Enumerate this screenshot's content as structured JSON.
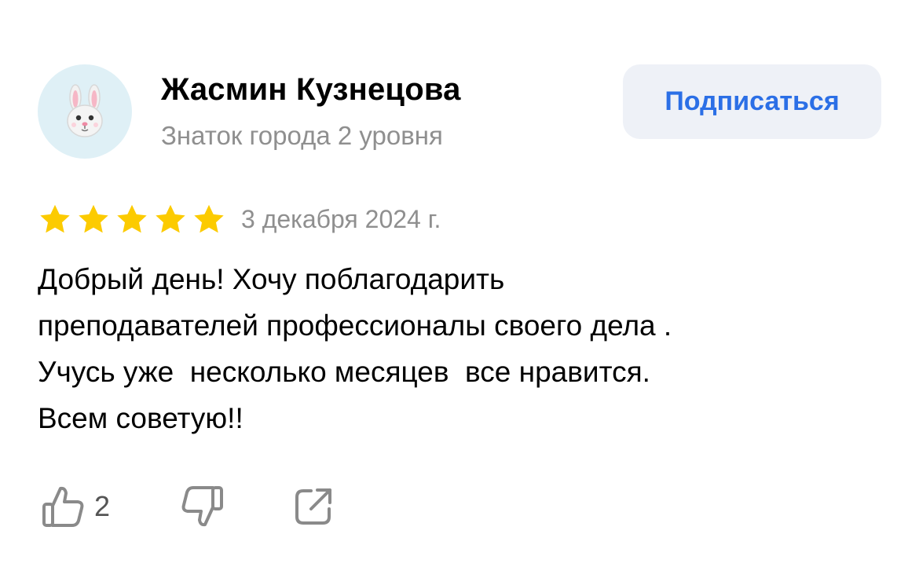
{
  "author": {
    "name": "Жасмин Кузнецова",
    "level": "Знаток города 2 уровня",
    "avatar_icon": "rabbit-face-icon"
  },
  "subscribe_label": "Подписаться",
  "review": {
    "rating": 5,
    "rating_max": 5,
    "date": "3 декабря 2024 г.",
    "text": "Добрый день! Хочу поблагодарить\nпреподавателей профессионалы своего дела .\nУчусь уже  несколько месяцев  все нравится.\nВсем советую!!"
  },
  "actions": {
    "like_count": "2",
    "like_icon": "thumbs-up-icon",
    "dislike_icon": "thumbs-down-icon",
    "share_icon": "share-icon"
  },
  "colors": {
    "accent": "#2b6fe6",
    "star": "#fccb00",
    "muted_text": "#8f8f8f",
    "avatar_bg": "#dff0f6",
    "button_bg": "#eef1f7"
  }
}
